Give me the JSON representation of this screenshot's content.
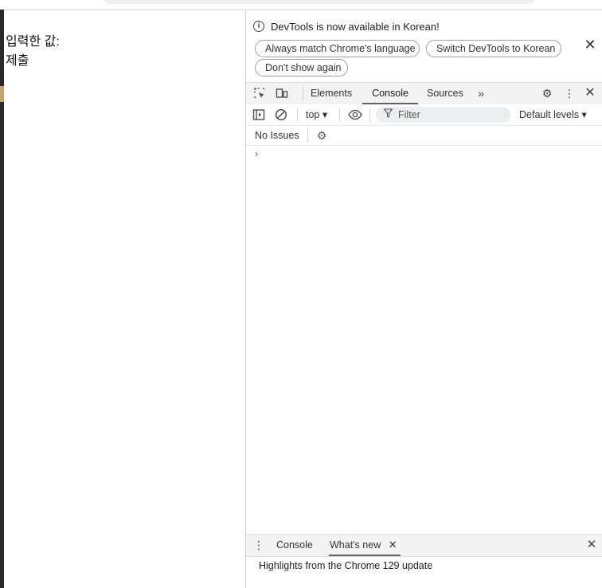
{
  "page": {
    "lines": [
      "입력한 값:",
      "제출"
    ]
  },
  "devtools": {
    "banner": {
      "message": "DevTools is now available in Korean!",
      "buttons": [
        "Always match Chrome's language",
        "Switch DevTools to Korean",
        "Don't show again"
      ]
    },
    "tabs": [
      "Elements",
      "Console",
      "Sources"
    ],
    "active_tab": "Console",
    "console_toolbar": {
      "context": "top",
      "filter_placeholder": "Filter",
      "levels": "Default levels"
    },
    "issues": "No Issues",
    "prompt": "›",
    "drawer": {
      "tabs": [
        "Console",
        "What's new"
      ],
      "active_tab": "What's new",
      "content": "Highlights from the Chrome 129 update"
    }
  },
  "icons": {
    "info": "info-icon",
    "close": "close-icon",
    "inspect": "inspect-element-icon",
    "device": "device-toolbar-icon",
    "more_tabs": "chevron-double-right-icon",
    "settings": "gear-icon",
    "menu": "kebab-menu-icon",
    "sidebar": "sidebar-toggle-icon",
    "clear": "clear-console-icon",
    "eye": "live-expression-icon",
    "filter": "filter-icon"
  }
}
